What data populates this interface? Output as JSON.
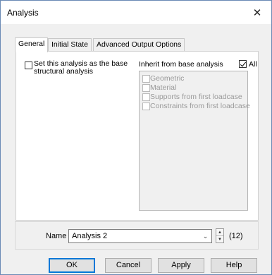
{
  "window": {
    "title": "Analysis",
    "close_glyph": "✕"
  },
  "tabs": [
    {
      "label": "General",
      "active": true
    },
    {
      "label": "Initial State",
      "active": false
    },
    {
      "label": "Advanced Output Options",
      "active": false
    }
  ],
  "general": {
    "base_checkbox": {
      "label_line1": "Set this analysis as the base",
      "label_line2": "structural analysis",
      "checked": false
    },
    "inherit_label": "Inherit from base analysis",
    "all_checkbox": {
      "label": "All",
      "checked": true
    },
    "inherit_items": [
      {
        "label": "Geometric",
        "enabled": false
      },
      {
        "label": "Material",
        "enabled": false
      },
      {
        "label": "Supports from first loadcase",
        "enabled": false
      },
      {
        "label": "Constraints from first loadcase",
        "enabled": false
      }
    ]
  },
  "name_row": {
    "label": "Name",
    "value": "Analysis 2",
    "count": "(12)"
  },
  "buttons": {
    "ok": "OK",
    "cancel": "Cancel",
    "apply": "Apply",
    "help": "Help"
  },
  "colors": {
    "window_border": "#6a8ab5",
    "default_button_border": "#0078d7",
    "disabled_text": "#9a9a9a"
  }
}
